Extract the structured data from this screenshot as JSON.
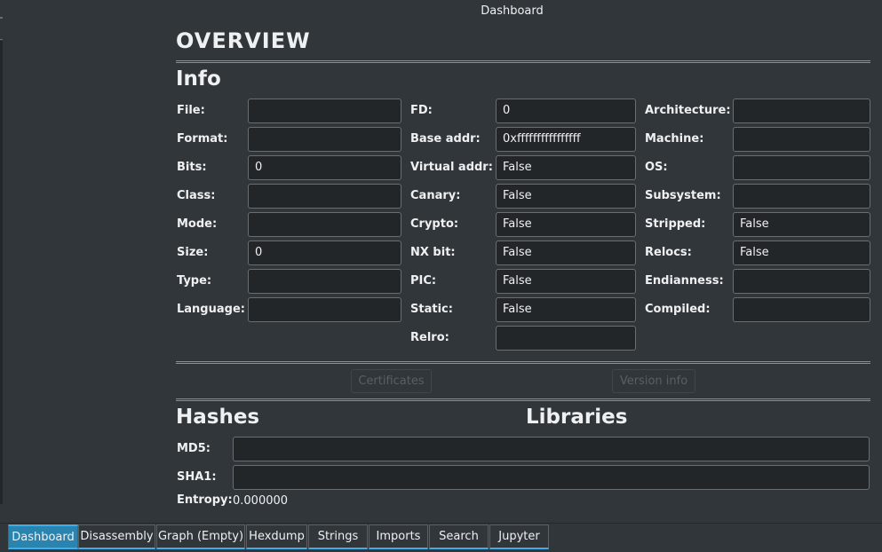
{
  "window": {
    "title": "Dashboard"
  },
  "overview": {
    "title": "OVERVIEW"
  },
  "info": {
    "title": "Info",
    "col1": [
      {
        "label": "File:",
        "value": ""
      },
      {
        "label": "Format:",
        "value": ""
      },
      {
        "label": "Bits:",
        "value": "0"
      },
      {
        "label": "Class:",
        "value": ""
      },
      {
        "label": "Mode:",
        "value": ""
      },
      {
        "label": "Size:",
        "value": "0"
      },
      {
        "label": "Type:",
        "value": ""
      },
      {
        "label": "Language:",
        "value": ""
      }
    ],
    "col2": [
      {
        "label": "FD:",
        "value": "0"
      },
      {
        "label": "Base addr:",
        "value": "0xffffffffffffffff"
      },
      {
        "label": "Virtual addr:",
        "value": "False"
      },
      {
        "label": "Canary:",
        "value": "False"
      },
      {
        "label": "Crypto:",
        "value": "False"
      },
      {
        "label": "NX bit:",
        "value": "False"
      },
      {
        "label": "PIC:",
        "value": "False"
      },
      {
        "label": "Static:",
        "value": "False"
      },
      {
        "label": "Relro:",
        "value": ""
      }
    ],
    "col3": [
      {
        "label": "Architecture:",
        "value": ""
      },
      {
        "label": "Machine:",
        "value": ""
      },
      {
        "label": "OS:",
        "value": ""
      },
      {
        "label": "Subsystem:",
        "value": ""
      },
      {
        "label": "Stripped:",
        "value": "False"
      },
      {
        "label": "Relocs:",
        "value": "False"
      },
      {
        "label": "Endianness:",
        "value": ""
      },
      {
        "label": "Compiled:",
        "value": ""
      }
    ]
  },
  "buttons": {
    "certificates": "Certificates",
    "version_info": "Version info"
  },
  "hashes": {
    "title": "Hashes",
    "md5_label": "MD5:",
    "md5": "",
    "sha1_label": "SHA1:",
    "sha1": "",
    "entropy_label": "Entropy:",
    "entropy": "0.000000"
  },
  "libraries": {
    "title": "Libraries"
  },
  "tabs": [
    {
      "label": "Dashboard",
      "active": true
    },
    {
      "label": "Disassembly"
    },
    {
      "label": "Graph (Empty)"
    },
    {
      "label": "Hexdump"
    },
    {
      "label": "Strings"
    },
    {
      "label": "Imports"
    },
    {
      "label": "Search"
    },
    {
      "label": "Jupyter"
    }
  ],
  "colors": {
    "background": "#31363b",
    "input": "#232629",
    "accent": "#3daee9",
    "active_tab": "#2a84b0"
  }
}
